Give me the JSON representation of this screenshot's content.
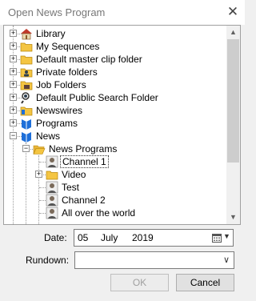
{
  "window": {
    "title": "Open News Program",
    "close_glyph": "✕"
  },
  "tree": {
    "items": [
      {
        "label": "Library",
        "icon": "library-icon",
        "expander": "+"
      },
      {
        "label": "My Sequences",
        "icon": "folder-icon",
        "expander": "+"
      },
      {
        "label": "Default master clip folder",
        "icon": "folder-icon",
        "expander": "+"
      },
      {
        "label": "Private folders",
        "icon": "private-folders-icon",
        "expander": "+"
      },
      {
        "label": "Job Folders",
        "icon": "job-folder-icon",
        "expander": "+"
      },
      {
        "label": "Default Public Search Folder",
        "icon": "search-folder-icon",
        "expander": "+"
      },
      {
        "label": "Newswires",
        "icon": "newswires-icon",
        "expander": "+"
      },
      {
        "label": "Programs",
        "icon": "programs-icon",
        "expander": "+"
      },
      {
        "label": "News",
        "icon": "news-icon",
        "expander": "−"
      },
      {
        "label": "News Programs",
        "icon": "open-folder-icon",
        "expander": "−"
      },
      {
        "label": "Channel 1",
        "icon": "program-icon",
        "selected": true
      },
      {
        "label": "Video",
        "icon": "folder-icon",
        "expander": "+"
      },
      {
        "label": "Test",
        "icon": "program-icon"
      },
      {
        "label": "Channel 2",
        "icon": "program-icon"
      },
      {
        "label": "All over the world",
        "icon": "program-icon"
      }
    ],
    "scroll_up_glyph": "▲",
    "scroll_down_glyph": "▼"
  },
  "form": {
    "date_label": "Date:",
    "date_day": "05",
    "date_month": "July",
    "date_year": "2019",
    "rundown_label": "Rundown:",
    "rundown_value": "",
    "dropdown_glyph": "▼",
    "chevron_glyph": "∨"
  },
  "buttons": {
    "ok": "OK",
    "cancel": "Cancel"
  },
  "colors": {
    "accent_blue": "#1e6fd9",
    "folder_yellow": "#f4c542",
    "disabled_text": "#a0a0a0"
  }
}
